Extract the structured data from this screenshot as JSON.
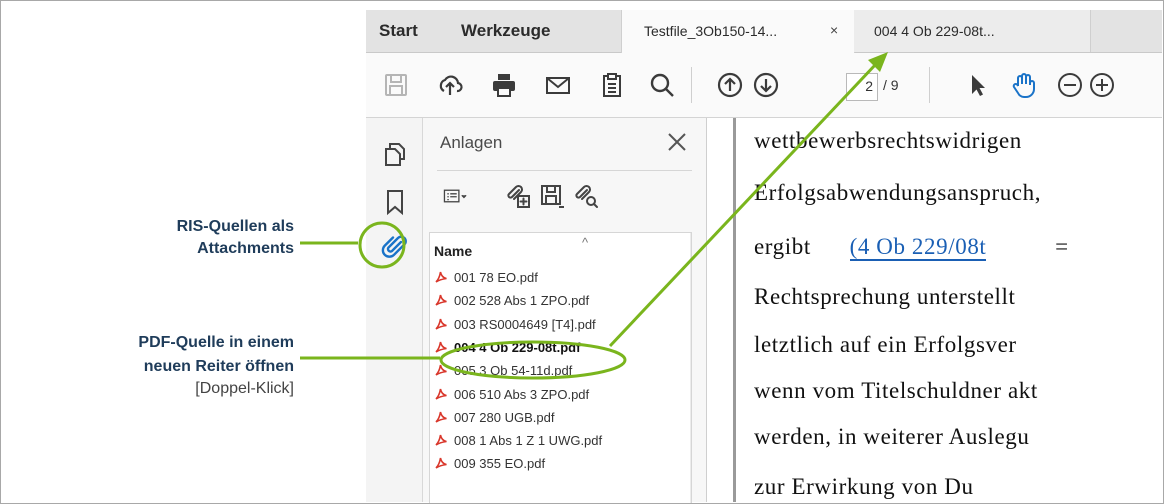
{
  "tabs": {
    "start": "Start",
    "tools": "Werkzeuge",
    "doc1": "Testfile_3Ob150-14...",
    "doc1_close": "×",
    "doc2": "004  4 Ob 229-08t..."
  },
  "toolbar": {
    "page_current": "2",
    "page_total": "/ 9",
    "icons": [
      "save-icon",
      "cloud-upload-icon",
      "print-icon",
      "mail-icon",
      "clipboard-icon",
      "search-icon",
      "page-up-icon",
      "page-down-icon",
      "select-cursor-icon",
      "hand-tool-icon",
      "zoom-out-icon",
      "zoom-in-icon"
    ]
  },
  "sidebar": {
    "icons": [
      "pages-icon",
      "bookmark-icon",
      "attachment-icon"
    ]
  },
  "attachments_panel": {
    "title": "Anlagen",
    "column_name": "Name",
    "items": [
      "001 78 EO.pdf",
      "002 528 Abs 1 ZPO.pdf",
      "003 RS0004649 [T4].pdf",
      "004 4 Ob 229-08t.pdf",
      "005 3 Ob 54-11d.pdf",
      "006 510 Abs 3 ZPO.pdf",
      "007 280 UGB.pdf",
      "008 1 Abs 1 Z 1 UWG.pdf",
      "009 355 EO.pdf"
    ],
    "selected_index": 3
  },
  "document": {
    "lines": [
      "wettbewerbsrechtswidrigen",
      "Erfolgsabwendungsanspruch,",
      "Rechtsprechung  unterstellt",
      "letztlich  auf  ein  Erfolgsver",
      "wenn vom Titelschuldner akt",
      "werden,  in  weiterer  Auslegu",
      "zur      Erwirkung      von      Du"
    ],
    "line3_prefix": "ergibt",
    "line3_link": "(4 Ob 229/08t",
    "line3_suffix": "="
  },
  "annotations": {
    "ris_line1": "RIS-Quellen als",
    "ris_line2": "Attachments",
    "pdf_line1": "PDF-Quelle in einem",
    "pdf_line2": "neuen Reiter öffnen",
    "pdf_line3": "[Doppel-Klick]"
  },
  "colors": {
    "highlight_green": "#7ab51d",
    "pdf_icon_red": "#d9372b",
    "link_blue": "#1a5fb4",
    "annotation_text": "#1f3c5a"
  }
}
